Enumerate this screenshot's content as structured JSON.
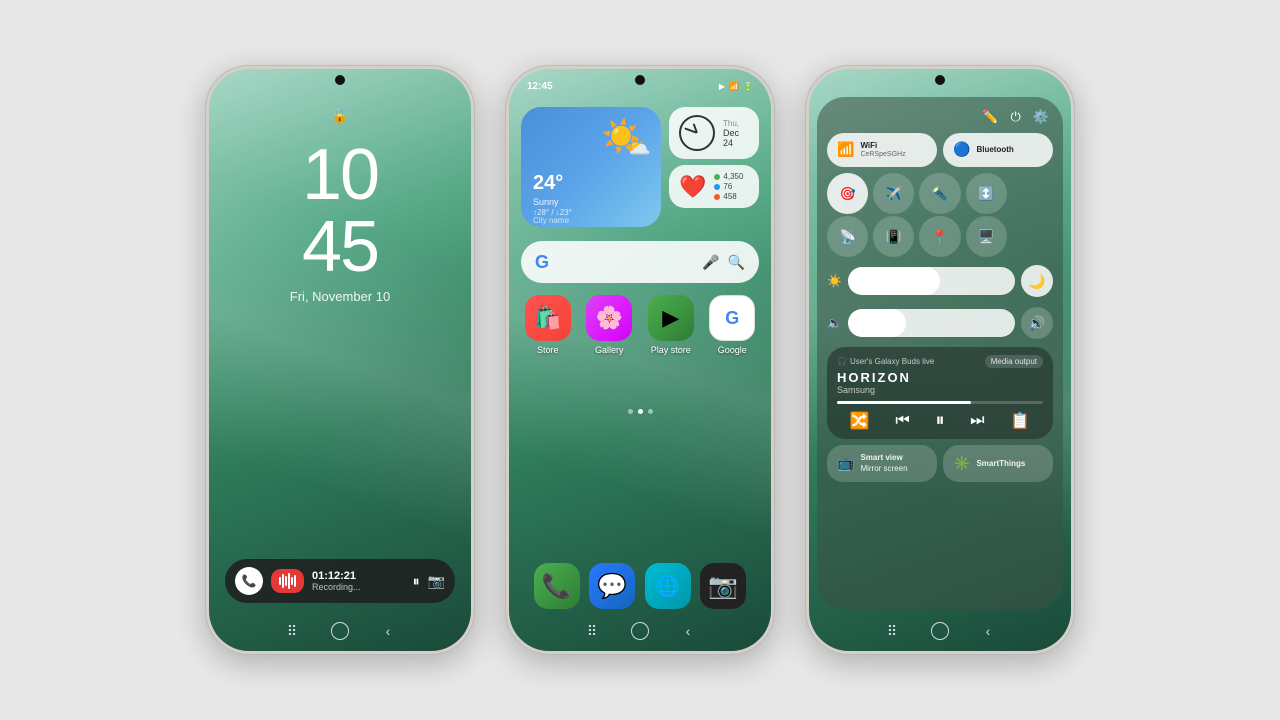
{
  "phones": [
    {
      "id": "lockscreen",
      "time": "10",
      "minutes": "45",
      "date": "Fri, November 10",
      "recording_timer": "01:12:21",
      "recording_label": "Recording..."
    },
    {
      "id": "homescreen",
      "status_time": "12:45",
      "weather": {
        "temp": "24°",
        "desc": "Sunny",
        "range": "↑28° / ↓23°",
        "city": "City name"
      },
      "clock_widget": {
        "day": "Thu,",
        "date": "Dec 24"
      },
      "health": {
        "steps": "4,350",
        "heart": "76",
        "calories": "458"
      },
      "apps": [
        {
          "label": "Store",
          "icon": "🛍️"
        },
        {
          "label": "Gallery",
          "icon": "🌸"
        },
        {
          "label": "Play store",
          "icon": "▶️"
        },
        {
          "label": "Google",
          "icon": "G"
        }
      ],
      "dock_apps": [
        {
          "label": "Phone",
          "icon": "📞"
        },
        {
          "label": "Messages",
          "icon": "💬"
        },
        {
          "label": "Internet",
          "icon": "🌐"
        },
        {
          "label": "Camera",
          "icon": "📷"
        }
      ]
    },
    {
      "id": "controlcenter",
      "wifi": {
        "label": "WiFi",
        "sub": "CeRSpeSGHz",
        "active": true
      },
      "bluetooth": {
        "label": "Bluetooth",
        "active": true
      },
      "media": {
        "device": "User's Galaxy Buds live",
        "title": "HORIZON",
        "artist": "Samsung",
        "output_label": "Media output"
      },
      "smart_view": "Smart view",
      "smart_view_sub": "Mirror screen",
      "smart_things": "SmartThings"
    }
  ]
}
